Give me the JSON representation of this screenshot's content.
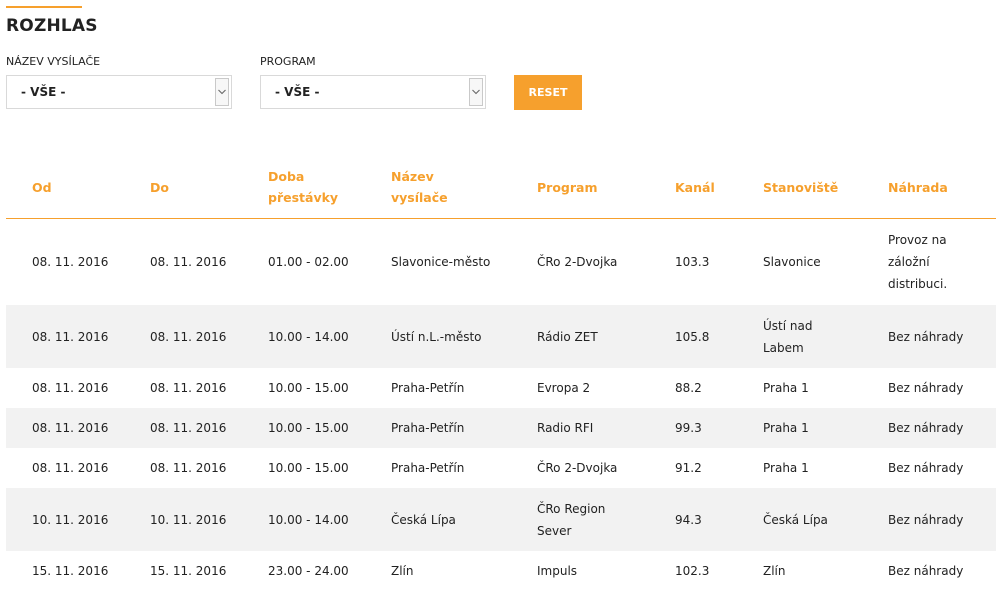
{
  "page": {
    "title": "ROZHLAS",
    "accent_color": "#f6a02d",
    "shade_color": "#f2f2f2"
  },
  "filters": {
    "transmitter_label": "NÁZEV VYSÍLAČE",
    "transmitter_value": "- VŠE -",
    "program_label": "PROGRAM",
    "program_value": "- VŠE -",
    "reset_label": "RESET",
    "dropdown_icon": "chevron-down-icon"
  },
  "table": {
    "headers": {
      "od": "Od",
      "do": "Do",
      "doba": "Doba přestávky",
      "nazev": "Název vysílače",
      "program": "Program",
      "kanal": "Kanál",
      "stanoviste": "Stanoviště",
      "nahrada": "Náhrada"
    },
    "rows": [
      {
        "od": "08. 11. 2016",
        "do": "08. 11. 2016",
        "doba": "01.00 - 02.00",
        "nazev": "Slavonice-město",
        "program": "ČRo 2-Dvojka",
        "kanal": "103.3",
        "stanoviste": "Slavonice",
        "nahrada": "Provoz na záložní distribuci."
      },
      {
        "od": "08. 11. 2016",
        "do": "08. 11. 2016",
        "doba": "10.00 - 14.00",
        "nazev": "Ústí n.L.-město",
        "program": "Rádio ZET",
        "kanal": "105.8",
        "stanoviste": "Ústí nad Labem",
        "nahrada": "Bez náhrady"
      },
      {
        "od": "08. 11. 2016",
        "do": "08. 11. 2016",
        "doba": "10.00 - 15.00",
        "nazev": "Praha-Petřín",
        "program": "Evropa 2",
        "kanal": "88.2",
        "stanoviste": "Praha 1",
        "nahrada": "Bez náhrady"
      },
      {
        "od": "08. 11. 2016",
        "do": "08. 11. 2016",
        "doba": "10.00 - 15.00",
        "nazev": "Praha-Petřín",
        "program": "Radio RFI",
        "kanal": "99.3",
        "stanoviste": "Praha 1",
        "nahrada": "Bez náhrady"
      },
      {
        "od": "08. 11. 2016",
        "do": "08. 11. 2016",
        "doba": "10.00 - 15.00",
        "nazev": "Praha-Petřín",
        "program": "ČRo 2-Dvojka",
        "kanal": "91.2",
        "stanoviste": "Praha 1",
        "nahrada": "Bez náhrady"
      },
      {
        "od": "10. 11. 2016",
        "do": "10. 11. 2016",
        "doba": "10.00 - 14.00",
        "nazev": "Česká Lípa",
        "program": "ČRo Region Sever",
        "kanal": "94.3",
        "stanoviste": "Česká Lípa",
        "nahrada": "Bez náhrady"
      },
      {
        "od": "15. 11. 2016",
        "do": "15. 11. 2016",
        "doba": "23.00 - 24.00",
        "nazev": "Zlín",
        "program": "Impuls",
        "kanal": "102.3",
        "stanoviste": "Zlín",
        "nahrada": "Bez náhrady"
      }
    ]
  }
}
